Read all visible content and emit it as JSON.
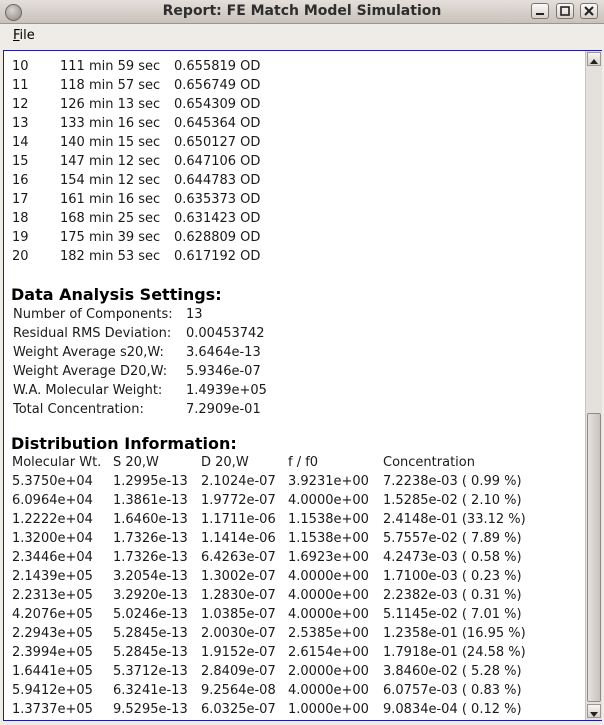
{
  "window": {
    "title": "Report:  FE Match Model Simulation"
  },
  "menu": {
    "file_accel": "F",
    "file_rest": "ile"
  },
  "observations": [
    {
      "idx": "10",
      "time": "111 min 59 sec",
      "od": "0.655819 OD"
    },
    {
      "idx": "11",
      "time": "118 min 57 sec",
      "od": "0.656749 OD"
    },
    {
      "idx": "12",
      "time": "126 min 13 sec",
      "od": "0.654309 OD"
    },
    {
      "idx": "13",
      "time": "133 min 16 sec",
      "od": "0.645364 OD"
    },
    {
      "idx": "14",
      "time": "140 min 15 sec",
      "od": "0.650127 OD"
    },
    {
      "idx": "15",
      "time": "147 min 12 sec",
      "od": "0.647106 OD"
    },
    {
      "idx": "16",
      "time": "154 min 12 sec",
      "od": "0.644783 OD"
    },
    {
      "idx": "17",
      "time": "161 min 16 sec",
      "od": "0.635373 OD"
    },
    {
      "idx": "18",
      "time": "168 min 25 sec",
      "od": "0.631423 OD"
    },
    {
      "idx": "19",
      "time": "175 min 39 sec",
      "od": "0.628809 OD"
    },
    {
      "idx": "20",
      "time": "182 min 53 sec",
      "od": "0.617192 OD"
    }
  ],
  "settings": {
    "heading": "Data Analysis Settings:",
    "rows": [
      {
        "label": "Number of Components:",
        "value": "13"
      },
      {
        "label": "Residual RMS Deviation:",
        "value": "0.00453742"
      },
      {
        "label": "Weight Average s20,W:",
        "value": "3.6464e-13"
      },
      {
        "label": "Weight Average D20,W:",
        "value": "5.9346e-07"
      },
      {
        "label": "W.A. Molecular Weight:",
        "value": "1.4939e+05"
      },
      {
        "label": "Total Concentration:",
        "value": "7.2909e-01"
      }
    ]
  },
  "distribution": {
    "heading": "Distribution Information:",
    "headers": [
      "Molecular Wt.",
      "S 20,W",
      "D 20,W",
      "f / f0",
      "Concentration"
    ],
    "rows": [
      [
        "5.3750e+04",
        "1.2995e-13",
        "2.1024e-07",
        "3.9231e+00",
        "7.2238e-03 ( 0.99 %)"
      ],
      [
        "6.0964e+04",
        "1.3861e-13",
        "1.9772e-07",
        "4.0000e+00",
        "1.5285e-02 ( 2.10 %)"
      ],
      [
        "1.2222e+04",
        "1.6460e-13",
        "1.1711e-06",
        "1.1538e+00",
        "2.4148e-01 (33.12 %)"
      ],
      [
        "1.3200e+04",
        "1.7326e-13",
        "1.1414e-06",
        "1.1538e+00",
        "5.7557e-02 ( 7.89 %)"
      ],
      [
        "2.3446e+04",
        "1.7326e-13",
        "6.4263e-07",
        "1.6923e+00",
        "4.2473e-03 ( 0.58 %)"
      ],
      [
        "2.1439e+05",
        "3.2054e-13",
        "1.3002e-07",
        "4.0000e+00",
        "1.7100e-03 ( 0.23 %)"
      ],
      [
        "2.2313e+05",
        "3.2920e-13",
        "1.2830e-07",
        "4.0000e+00",
        "2.2382e-03 ( 0.31 %)"
      ],
      [
        "4.2076e+05",
        "5.0246e-13",
        "1.0385e-07",
        "4.0000e+00",
        "5.1145e-02 ( 7.01 %)"
      ],
      [
        "2.2943e+05",
        "5.2845e-13",
        "2.0030e-07",
        "2.5385e+00",
        "1.2358e-01 (16.95 %)"
      ],
      [
        "2.3994e+05",
        "5.2845e-13",
        "1.9152e-07",
        "2.6154e+00",
        "1.7918e-01 (24.58 %)"
      ],
      [
        "1.6441e+05",
        "5.3712e-13",
        "2.8409e-07",
        "2.0000e+00",
        "3.8460e-02 ( 5.28 %)"
      ],
      [
        "5.9412e+05",
        "6.3241e-13",
        "9.2564e-08",
        "4.0000e+00",
        "6.0757e-03 ( 0.83 %)"
      ],
      [
        "1.3737e+05",
        "9.5295e-13",
        "6.0325e-07",
        "1.0000e+00",
        "9.0834e-04 ( 0.12 %)"
      ]
    ]
  }
}
